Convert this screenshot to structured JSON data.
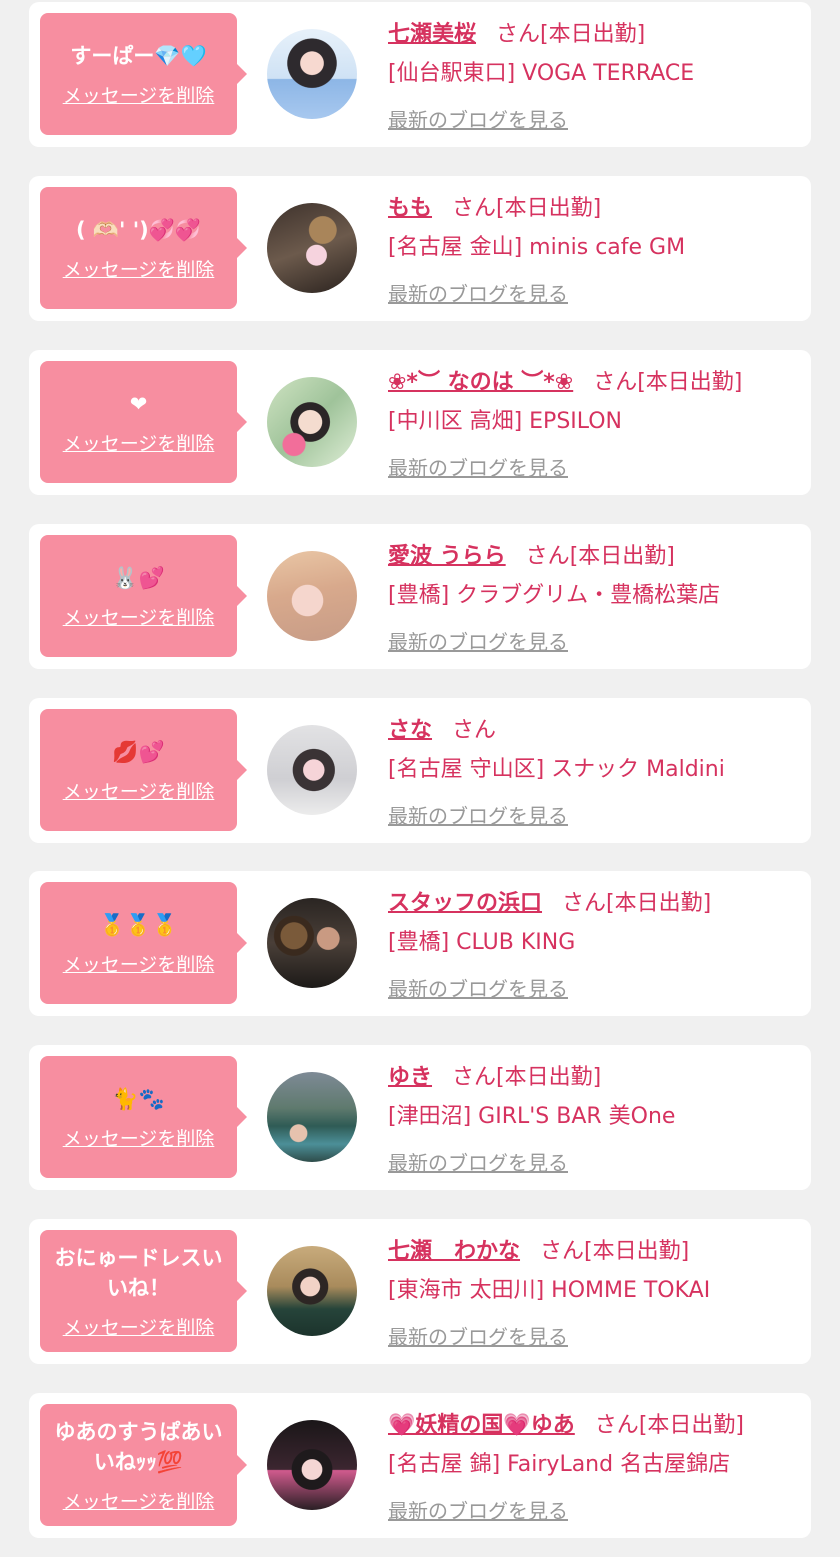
{
  "colors": {
    "bubble": "#f78ea0",
    "accent": "#d6325f",
    "link_gray": "#999999",
    "page_bg": "#f0f0f0"
  },
  "items": [
    {
      "message": "すーぱー💎🩵",
      "delete_label": "メッセージを削除",
      "name": "七瀬美桜",
      "san": "さん",
      "status": "[本日出勤]",
      "shop": "[仙台駅東口] VOGA TERRACE",
      "blog_label": "最新のブログを見る"
    },
    {
      "message": "( 🫶🏻' ')💞💞",
      "delete_label": "メッセージを削除",
      "name": "もも",
      "san": "さん",
      "status": "[本日出勤]",
      "shop": "[名古屋 金山] minis cafe GM",
      "blog_label": "最新のブログを見る"
    },
    {
      "message": "❤︎",
      "delete_label": "メッセージを削除",
      "name": "❀*︶ なのは ︶*❀",
      "san": "さん",
      "status": "[本日出勤]",
      "shop": "[中川区 高畑] EPSILON",
      "blog_label": "最新のブログを見る"
    },
    {
      "message": "🐰💕",
      "delete_label": "メッセージを削除",
      "name": "愛波 うらら",
      "san": "さん",
      "status": "[本日出勤]",
      "shop": "[豊橋] クラブグリム・豊橋松葉店",
      "blog_label": "最新のブログを見る"
    },
    {
      "message": "💋💕",
      "delete_label": "メッセージを削除",
      "name": "さな",
      "san": "さん",
      "status": "",
      "shop": "[名古屋 守山区] スナック Maldini",
      "blog_label": "最新のブログを見る"
    },
    {
      "message": "🥇🥇🥇",
      "delete_label": "メッセージを削除",
      "name": "スタッフの浜口",
      "san": "さん",
      "status": "[本日出勤]",
      "shop": "[豊橋] CLUB KING",
      "blog_label": "最新のブログを見る"
    },
    {
      "message": "🐈🐾",
      "delete_label": "メッセージを削除",
      "name": "ゆき",
      "san": "さん",
      "status": "[本日出勤]",
      "shop": "[津田沼] GIRL'S BAR 美One",
      "blog_label": "最新のブログを見る"
    },
    {
      "message": "おにゅードレスいいね！",
      "delete_label": "メッセージを削除",
      "name": "七瀬　わかな",
      "san": "さん",
      "status": "[本日出勤]",
      "shop": "[東海市 太田川] HOMME TOKAI",
      "blog_label": "最新のブログを見る"
    },
    {
      "message": "ゆあのすうぱあいいねｯｯ💯",
      "delete_label": "メッセージを削除",
      "name": "💗妖精の国💗ゆあ",
      "san": "さん",
      "status": "[本日出勤]",
      "shop": "[名古屋 錦] FairyLand 名古屋錦店",
      "blog_label": "最新のブログを見る"
    }
  ]
}
